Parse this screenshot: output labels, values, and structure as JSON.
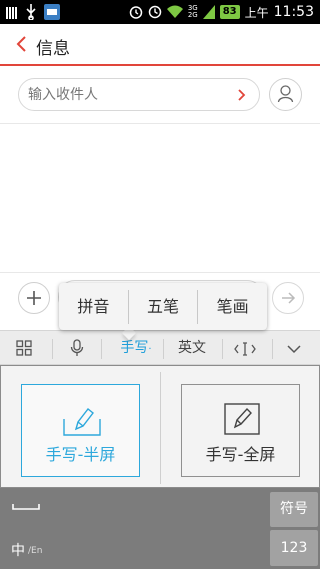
{
  "status_bar": {
    "time": "11:53",
    "am_pm": "上午",
    "battery": "83",
    "network_top": "3G",
    "network_bottom": "2G",
    "icons": [
      "signal-bars-icon",
      "usb-icon",
      "app-notification-icon",
      "alarm-icon",
      "wifi-icon",
      "battery-icon"
    ]
  },
  "header": {
    "title": "信息",
    "back_icon": "chevron-left-icon"
  },
  "recipient": {
    "placeholder": "输入收件人"
  },
  "compose": {
    "add_icon": "plus-icon",
    "send_icon": "arrow-right-icon"
  },
  "input_modes": [
    "拼音",
    "五笔",
    "笔画"
  ],
  "keyboard_toolbar": {
    "grid_icon": "grid-icon",
    "mic_icon": "microphone-icon",
    "handwriting": "手写",
    "english": "英文",
    "cursor_icon": "cursor-move-icon",
    "collapse_icon": "chevron-down-icon"
  },
  "handwriting_panel": {
    "half_screen": "手写-半屏",
    "full_screen": "手写-全屏"
  },
  "bottom_keys": {
    "lang_zh": "中",
    "lang_en": "/En",
    "symbol": "符号",
    "number": "123"
  },
  "colors": {
    "accent": "#e1453a",
    "keyboard_active": "#1e9ed9"
  }
}
